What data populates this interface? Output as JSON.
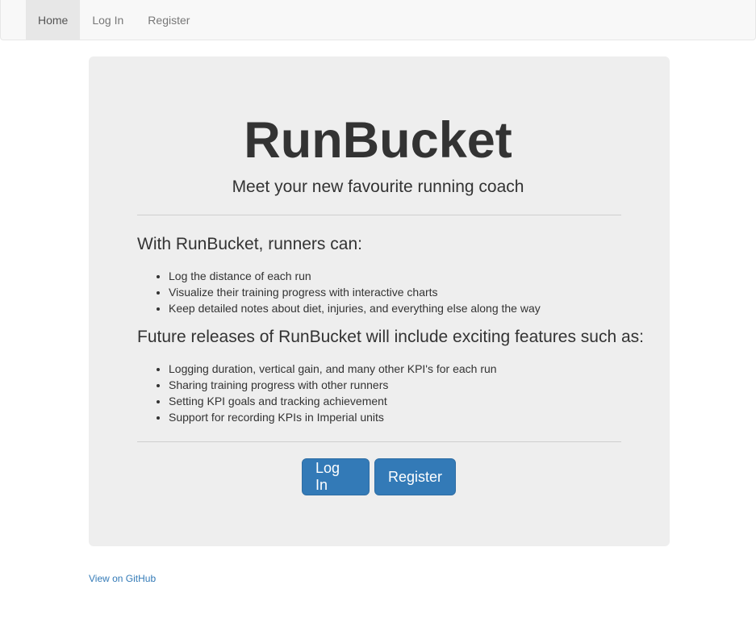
{
  "navbar": {
    "items": [
      {
        "label": "Home",
        "active": true
      },
      {
        "label": "Log In",
        "active": false
      },
      {
        "label": "Register",
        "active": false
      }
    ]
  },
  "hero": {
    "title": "RunBucket",
    "subtitle": "Meet your new favourite running coach"
  },
  "features": {
    "heading": "With RunBucket, runners can:",
    "items": [
      "Log the distance of each run",
      "Visualize their training progress with interactive charts",
      "Keep detailed notes about diet, injuries, and everything else along the way"
    ]
  },
  "future": {
    "heading": "Future releases of RunBucket will include exciting features such as:",
    "items": [
      "Logging duration, vertical gain, and many other KPI's for each run",
      "Sharing training progress with other runners",
      "Setting KPI goals and tracking achievement",
      "Support for recording KPIs in Imperial units"
    ]
  },
  "actions": {
    "login_label": "Log In",
    "register_label": "Register"
  },
  "footer": {
    "github_label": "View on GitHub"
  },
  "colors": {
    "primary": "#337ab7",
    "jumbotron_bg": "#eeeeee",
    "navbar_bg": "#f8f8f8"
  }
}
